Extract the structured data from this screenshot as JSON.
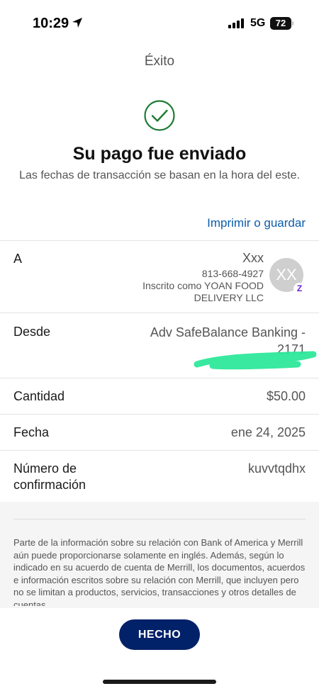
{
  "status_bar": {
    "time": "10:29",
    "network": "5G",
    "battery": "72"
  },
  "nav": {
    "title": "Éxito"
  },
  "confirmation": {
    "headline": "Su pago fue enviado",
    "subtext": "Las fechas de transacción se basan en la hora del este.",
    "icon": "checkmark-circle-icon",
    "icon_color": "#1e7b34"
  },
  "actions": {
    "print_label": "Imprimir o guardar"
  },
  "details": {
    "to": {
      "label": "A",
      "name": "Xxx",
      "phone": "813-668-4927",
      "enrolled": "Inscrito como YOAN FOOD DELIVERY LLC",
      "avatar_initials": "XX",
      "badge": "Z"
    },
    "from": {
      "label": "Desde",
      "account": "Adv SafeBalance Banking - 2171"
    },
    "amount": {
      "label": "Cantidad",
      "value": "$50.00"
    },
    "date": {
      "label": "Fecha",
      "value": "ene 24, 2025"
    },
    "confirmation_number": {
      "label": "Número de confirmación",
      "value": "kuvvtqdhx"
    }
  },
  "disclaimer": "Parte de la información sobre su relación con Bank of America y Merrill aún puede proporcionarse solamente en inglés. Además, según lo indicado en su acuerdo de cuenta de Merrill, los documentos, acuerdos e información escritos sobre su relación con Merrill, que incluyen pero no se limitan a productos, servicios, transacciones y otros detalles de cuentas",
  "done_button": {
    "label": "HECHO",
    "color": "#012169"
  },
  "colors": {
    "link": "#0b5cab",
    "redaction": "#2de89a"
  }
}
